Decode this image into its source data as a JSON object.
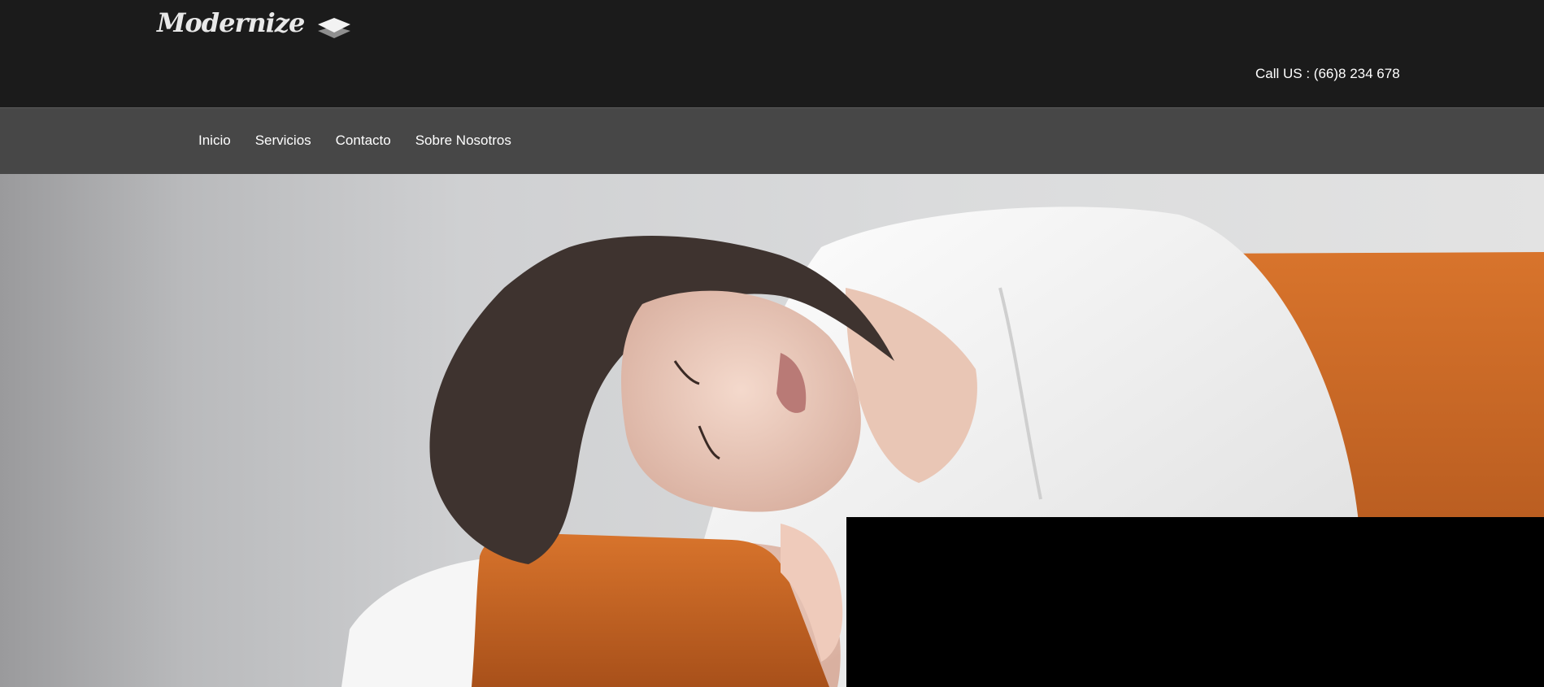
{
  "header": {
    "logo_text": "Modernize",
    "logo_icon": "layers-icon",
    "call_us": "Call US : (66)8 234 678"
  },
  "nav": {
    "items": [
      {
        "label": "Inicio"
      },
      {
        "label": "Servicios"
      },
      {
        "label": "Contacto"
      },
      {
        "label": "Sobre Nosotros"
      }
    ]
  },
  "hero": {
    "image": "woman-sleeping-on-sofa-image"
  },
  "colors": {
    "topbar": "#1b1b1b",
    "navbar": "#474747",
    "sofa": "#c9661f",
    "overlay": "#000000"
  }
}
